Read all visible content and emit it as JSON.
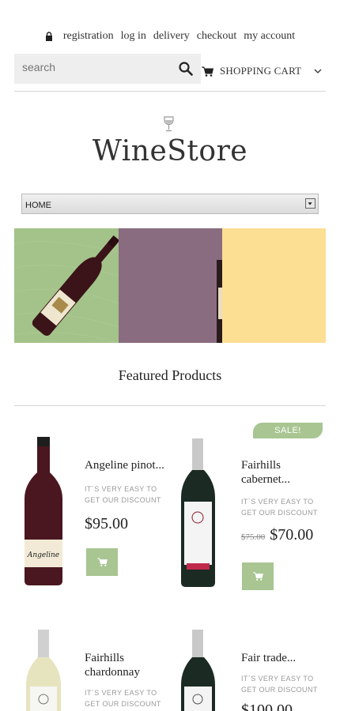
{
  "topnav": {
    "items": [
      "registration",
      "log in",
      "delivery",
      "checkout",
      "my account"
    ]
  },
  "search": {
    "placeholder": "search"
  },
  "cart": {
    "label": "SHOPPING CART"
  },
  "logo": {
    "text": "WineStore"
  },
  "menu": {
    "selected": "HOME"
  },
  "featured": {
    "title": "Featured Products"
  },
  "badges": {
    "sale": "SALE!"
  },
  "products": [
    {
      "name_l1": "Angeline pinot...",
      "name_l2": "",
      "desc_l1": "IT`S VERY EASY TO",
      "desc_l2": "GET OUR DISCOUNT",
      "price": "$95.00",
      "old_price": ""
    },
    {
      "name_l1": "Fairhills",
      "name_l2": "cabernet...",
      "desc_l1": "IT`S VERY EASY TO",
      "desc_l2": "GET OUR DISCOUNT",
      "price": "$70.00",
      "old_price": "$75.00"
    },
    {
      "name_l1": "Fairhills",
      "name_l2": "chardonnay",
      "desc_l1": "IT`S VERY EASY TO",
      "desc_l2": "GET OUR DISCOUNT",
      "price": "",
      "old_price": ""
    },
    {
      "name_l1": "Fair trade...",
      "name_l2": "",
      "desc_l1": "IT`S VERY EASY TO",
      "desc_l2": "GET OUR DISCOUNT",
      "price": "$100.00",
      "old_price": ""
    }
  ],
  "colors": {
    "accent": "#a8c592",
    "banner_green": "#a3c38a",
    "banner_purple": "#8a6c80",
    "banner_yellow": "#fddf94"
  },
  "icons": [
    "lock-icon",
    "search-icon",
    "cart-icon",
    "chevron-down-icon",
    "wine-glass-icon"
  ]
}
